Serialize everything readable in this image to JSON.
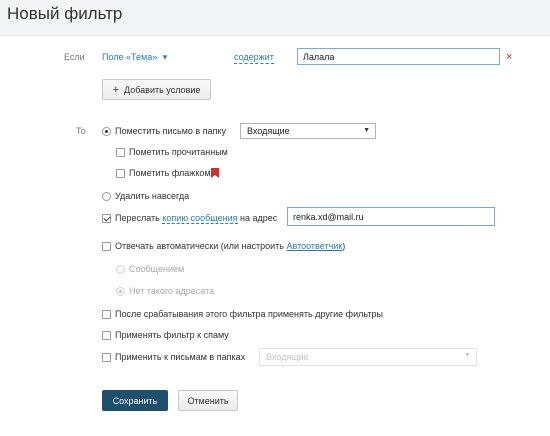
{
  "header": {
    "title": "Новый фильтр"
  },
  "condition": {
    "if_label": "Если",
    "field_select": "Поле «Тема»",
    "field_arrow": "▾",
    "operator": "содержит",
    "value": "Лалала",
    "add_condition_label": "Добавить условие"
  },
  "actions": {
    "to_label": "То",
    "move_to_folder": {
      "label": "Поместить письмо в папку",
      "checked": true,
      "folder": "Входящие"
    },
    "mark_read": {
      "label": "Пометить прочитанным",
      "checked": false
    },
    "mark_flag": {
      "label": "Пометить флажком",
      "checked": false
    },
    "delete_forever": {
      "label": "Удалить навсегда",
      "checked": false
    },
    "forward": {
      "label_prefix": "Переслать",
      "link": "копию сообщения",
      "label_suffix": "на адрес",
      "checked": true,
      "email": "renka.xd@mail.ru"
    },
    "auto_reply": {
      "label_prefix": "Отвечать автоматически (или настроить",
      "link": "Автоответчик",
      "label_suffix": ")",
      "checked": false,
      "options": [
        {
          "label": "Сообщением",
          "checked": false
        },
        {
          "label": "Нет такого адресата",
          "checked": true
        }
      ]
    },
    "apply_other_filters": {
      "label": "После срабатывания этого фильтра применять другие фильтры",
      "checked": false
    },
    "apply_to_spam": {
      "label": "Применять фильтр к спаму",
      "checked": false
    },
    "apply_to_folders": {
      "label": "Применить к письмам в папках",
      "checked": false,
      "folder": "Входящие"
    }
  },
  "buttons": {
    "save": "Сохранить",
    "cancel": "Отменить"
  },
  "colors": {
    "link": "#2a7bb8",
    "primary_button": "#1e4f6d",
    "flag": "#d32f2f",
    "remove": "#d32f2f"
  },
  "icons": {
    "plus": "+",
    "remove": "×",
    "select_arrow": "▼"
  }
}
